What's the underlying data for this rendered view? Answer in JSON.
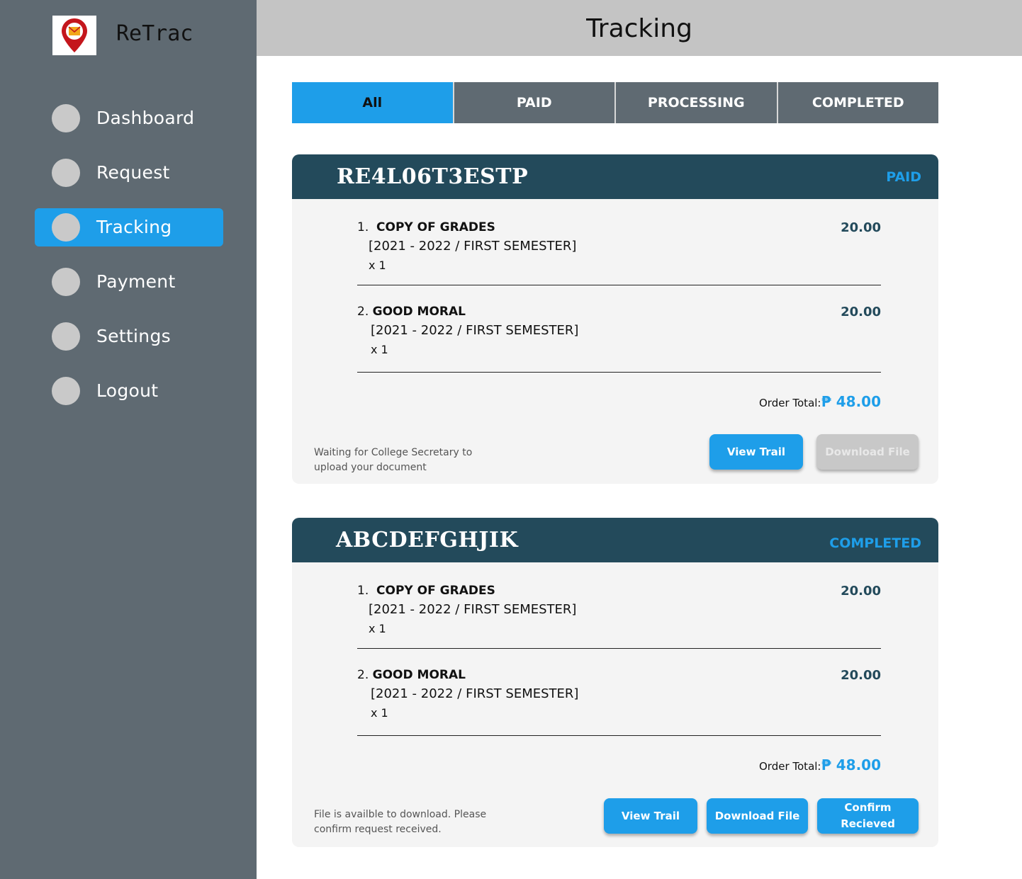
{
  "app": {
    "name": "ReTrac"
  },
  "sidebar": {
    "items": [
      {
        "label": "Dashboard"
      },
      {
        "label": "Request"
      },
      {
        "label": "Tracking"
      },
      {
        "label": "Payment"
      },
      {
        "label": "Settings"
      },
      {
        "label": "Logout"
      }
    ]
  },
  "header": {
    "title": "Tracking"
  },
  "tabs": [
    {
      "label": "All"
    },
    {
      "label": "PAID"
    },
    {
      "label": "PROCESSING"
    },
    {
      "label": "COMPLETED"
    }
  ],
  "orders": [
    {
      "id": "RE4L06T3ESTP",
      "status": "PAID",
      "items": [
        {
          "num": "1.",
          "name": "COPY OF GRADES",
          "term": "[2021 - 2022 / FIRST SEMESTER]",
          "qty": "x 1",
          "price": "20.00"
        },
        {
          "num": "2.",
          "name": "GOOD MORAL",
          "term": "[2021 - 2022 / FIRST SEMESTER]",
          "qty": "x 1",
          "price": "20.00"
        }
      ],
      "total_label": "Order Total:",
      "total": "₱ 48.00",
      "note": "Waiting for College Secretary to upload your document",
      "buttons": {
        "view_trail": "View Trail",
        "download": "Download File"
      }
    },
    {
      "id": "ABCDEFGHJIK",
      "status": "COMPLETED",
      "items": [
        {
          "num": "1.",
          "name": "COPY OF GRADES",
          "term": "[2021 - 2022 / FIRST SEMESTER]",
          "qty": "x 1",
          "price": "20.00"
        },
        {
          "num": "2.",
          "name": "GOOD MORAL",
          "term": "[2021 - 2022 / FIRST SEMESTER]",
          "qty": "x 1",
          "price": "20.00"
        }
      ],
      "total_label": "Order Total:",
      "total": "₱ 48.00",
      "note": "File is availble to download. Please confirm request received.",
      "buttons": {
        "view_trail": "View Trail",
        "download": "Download File",
        "confirm": "Confirm Recieved"
      }
    }
  ],
  "colors": {
    "sidebar": "#5f6a72",
    "accent": "#1e9ee9",
    "card_header": "#234a5b",
    "header": "#c4c4c4",
    "disabled": "#c8c8c8"
  },
  "icons": {
    "logo": "location-pin-mail-icon"
  }
}
